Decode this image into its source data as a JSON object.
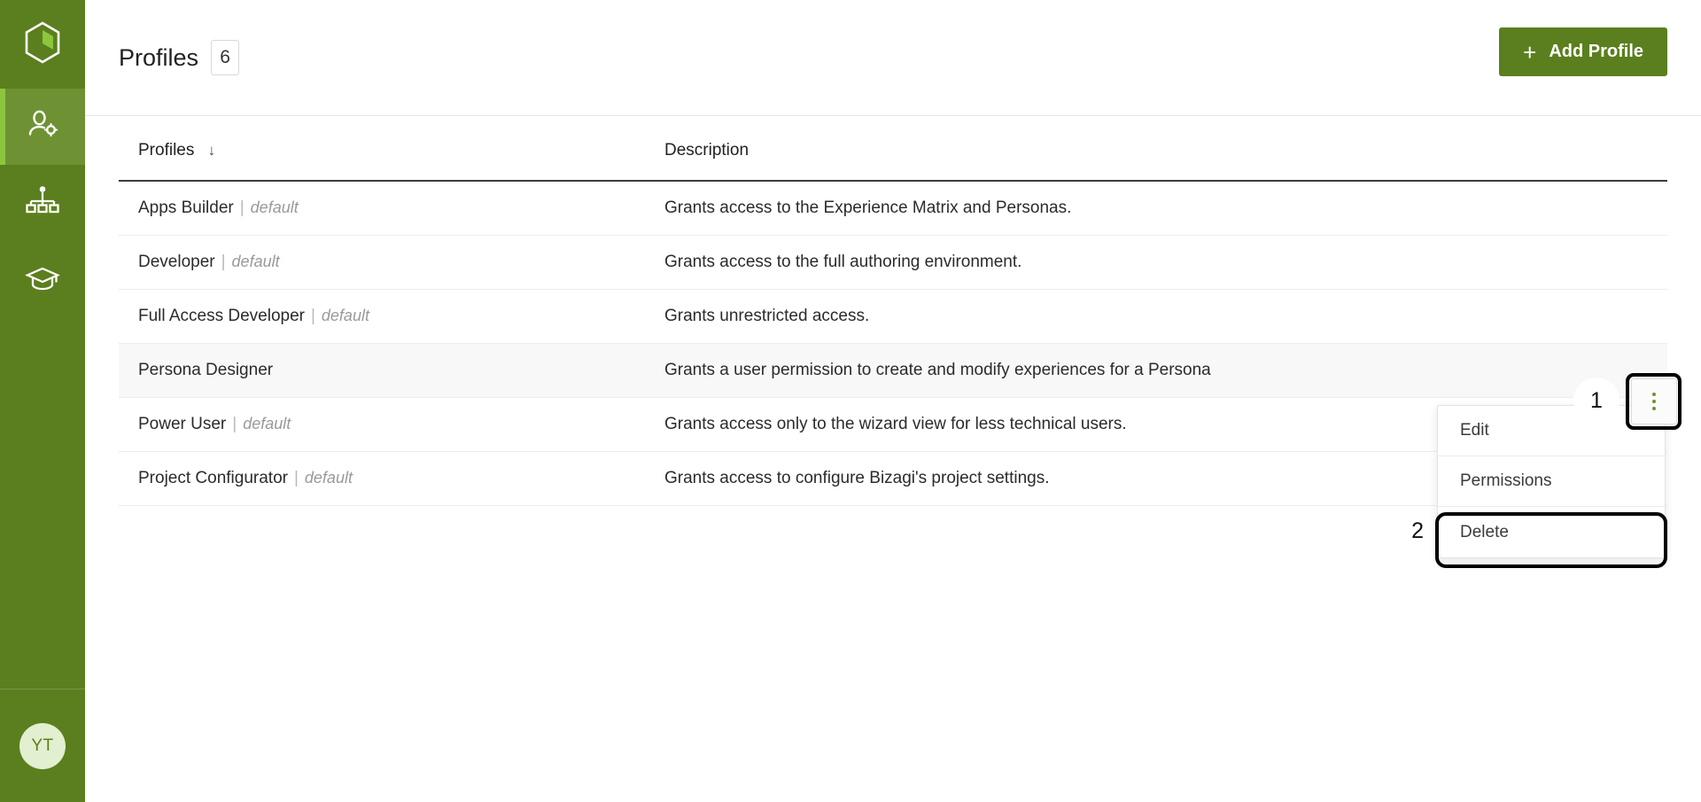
{
  "colors": {
    "sidebar_bg": "#5b7f1e",
    "sidebar_active_bg": "#6e9233",
    "sidebar_accent": "#8cc63e",
    "brand_green": "#5b7f1e",
    "kebab_dot": "#6e9233",
    "avatar_bg": "#e2efd0",
    "annotation": "#000000",
    "row_highlight": "#f8f8f8"
  },
  "sidebar": {
    "logo": {
      "icon": "hexagon-logo-icon"
    },
    "items": [
      {
        "icon": "user-settings-icon",
        "name": "sidebar-item-users",
        "active": true
      },
      {
        "icon": "org-chart-icon",
        "name": "sidebar-item-org-chart",
        "active": false
      },
      {
        "icon": "graduation-cap-icon",
        "name": "sidebar-item-learning",
        "active": false
      }
    ],
    "avatar": {
      "initials": "YT"
    }
  },
  "header": {
    "title": "Profiles",
    "count": "6",
    "add_button": {
      "label": "Add Profile",
      "icon": "plus-icon"
    }
  },
  "table": {
    "columns": [
      {
        "label": "Profiles",
        "sort_icon": "arrow-down-icon"
      },
      {
        "label": "Description"
      }
    ],
    "rows": [
      {
        "name": "Apps Builder",
        "tag": "default",
        "description": "Grants access to the Experience Matrix and Personas.",
        "highlighted": false
      },
      {
        "name": "Developer",
        "tag": "default",
        "description": "Grants access to the full authoring environment.",
        "highlighted": false
      },
      {
        "name": "Full Access Developer",
        "tag": "default",
        "description": "Grants unrestricted access.",
        "highlighted": false
      },
      {
        "name": "Persona Designer",
        "tag": "",
        "description": "Grants a user permission to create and modify experiences for a Persona",
        "highlighted": true
      },
      {
        "name": "Power User",
        "tag": "default",
        "description": "Grants access only to the wizard view for less technical users.",
        "highlighted": false
      },
      {
        "name": "Project Configurator",
        "tag": "default",
        "description": "Grants access to configure Bizagi's project settings.",
        "highlighted": false
      }
    ]
  },
  "row_menu": {
    "trigger": {
      "icon": "kebab-menu-icon"
    },
    "items": [
      {
        "label": "Edit"
      },
      {
        "label": "Permissions"
      },
      {
        "label": "Delete"
      }
    ]
  },
  "annotations": [
    {
      "number": "1",
      "target": "kebab-menu-button"
    },
    {
      "number": "2",
      "target": "menu-item-delete"
    }
  ]
}
